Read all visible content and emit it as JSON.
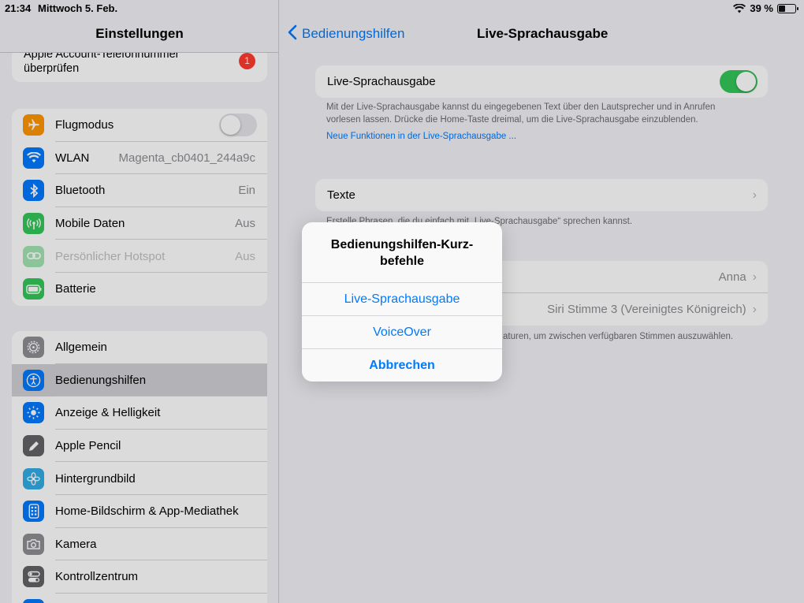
{
  "statusbar": {
    "time": "21:34",
    "date": "Mittwoch 5. Feb.",
    "battery_percent": "39 %",
    "battery_level": 0.39
  },
  "sidebar": {
    "title": "Einstellungen",
    "account": {
      "line1": "Apple Account-Telefonnummer",
      "line2": "überprüfen",
      "badge": "1"
    },
    "group1": [
      {
        "label": "Flugmodus",
        "value": "",
        "icon": "airplane-icon",
        "color": "#ff9500",
        "toggle": "off"
      },
      {
        "label": "WLAN",
        "value": "Magenta_cb0401_244a9c",
        "icon": "wifi-icon",
        "color": "#007aff"
      },
      {
        "label": "Bluetooth",
        "value": "Ein",
        "icon": "bluetooth-icon",
        "color": "#007aff"
      },
      {
        "label": "Mobile Daten",
        "value": "Aus",
        "icon": "antenna-icon",
        "color": "#34c759"
      },
      {
        "label": "Persönlicher Hotspot",
        "value": "Aus",
        "icon": "link-icon",
        "color": "#34c759",
        "disabled": true
      },
      {
        "label": "Batterie",
        "value": "",
        "icon": "battery-icon",
        "color": "#34c759"
      }
    ],
    "group2": [
      {
        "label": "Allgemein",
        "icon": "gear-icon",
        "color": "#8e8e93"
      },
      {
        "label": "Bedienungshilfen",
        "icon": "accessibility-icon",
        "color": "#007aff",
        "selected": true
      },
      {
        "label": "Anzeige & Helligkeit",
        "icon": "sun-icon",
        "color": "#007aff"
      },
      {
        "label": "Apple Pencil",
        "icon": "pencil-icon",
        "color": "#636366"
      },
      {
        "label": "Hintergrundbild",
        "icon": "flower-icon",
        "color": "#32ade6"
      },
      {
        "label": "Home-Bildschirm & App-Mediathek",
        "icon": "home-screen-icon",
        "color": "#007aff"
      },
      {
        "label": "Kamera",
        "icon": "camera-icon",
        "color": "#8e8e93"
      },
      {
        "label": "Kontrollzentrum",
        "icon": "switches-icon",
        "color": "#636366"
      }
    ]
  },
  "detail": {
    "back_label": "Bedienungshilfen",
    "title": "Live-Sprachausgabe",
    "main_toggle_label": "Live-Sprachausgabe",
    "main_toggle_state": "on",
    "description_line1": "Mit der Live-Sprachausgabe kannst du eingegebenen Text über den Lautsprecher und in Anrufen",
    "description_line2": "vorlesen lassen. Drücke die Home-Taste dreimal, um die Live-Sprachausgabe einzublenden.",
    "link": "Neue Funktionen in der Live-Sprachausgabe ...",
    "texte_label": "Texte",
    "texte_footer": "Erstelle Phrasen, die du einfach mit „Live-Sprachausgabe“ sprechen kannst.",
    "voice_rows": [
      {
        "label": "",
        "value": "Anna"
      },
      {
        "label": "",
        "value": "Siri Stimme 3 (Vereinigtes Königreich)"
      }
    ],
    "voice_footer": "aturen, um zwischen verfügbaren Stimmen auszuwählen."
  },
  "sheet": {
    "title_line1": "Bedienungshilfen-Kurz-",
    "title_line2": "befehle",
    "options": [
      "Live-Sprachausgabe",
      "VoiceOver"
    ],
    "cancel": "Abbrechen"
  }
}
